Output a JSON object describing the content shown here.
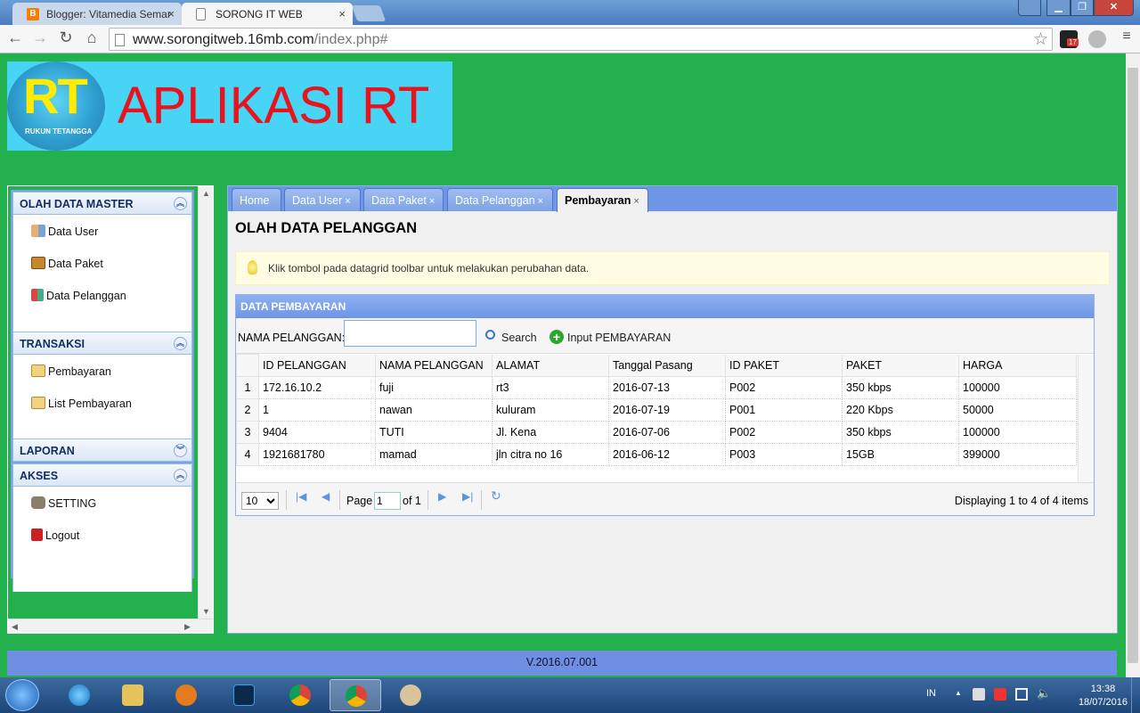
{
  "browser": {
    "tabs": [
      {
        "title": "Blogger: Vitamedia Semar",
        "close": "×"
      },
      {
        "title": "SORONG IT WEB",
        "close": "×"
      }
    ],
    "window_buttons": {
      "min": "▁",
      "max": "❐",
      "close": "✕",
      "user": "👤"
    },
    "url_host": "www.sorongitweb.16mb.com",
    "url_path": "/index.php#",
    "badge": "17"
  },
  "header": {
    "logo_text": "RT",
    "logo_subtext": "RUKUN TETANGGA",
    "title": "APLIKASI RT"
  },
  "sidebar": {
    "sections": [
      {
        "title": "OLAH DATA MASTER",
        "toggle": "︽",
        "items": [
          "Data User",
          "Data Paket",
          "Data Pelanggan"
        ]
      },
      {
        "title": "TRANSAKSI",
        "toggle": "︽",
        "items": [
          "Pembayaran",
          "List Pembayaran"
        ]
      },
      {
        "title": "LAPORAN",
        "toggle": "︾",
        "items": []
      },
      {
        "title": "AKSES",
        "toggle": "︽",
        "items": [
          "SETTING",
          "Logout"
        ]
      }
    ]
  },
  "main": {
    "tabs": [
      {
        "label": "Home",
        "close": ""
      },
      {
        "label": "Data User",
        "close": "×"
      },
      {
        "label": "Data Paket",
        "close": "×"
      },
      {
        "label": "Data Pelanggan",
        "close": "×"
      },
      {
        "label": "Pembayaran",
        "close": "×"
      }
    ],
    "page_title": "OLAH DATA PELANGGAN",
    "info": "Klik tombol pada datagrid toolbar untuk melakukan perubahan data.",
    "grid": {
      "title": "DATA PEMBAYARAN",
      "search_label": "NAMA PELANGGAN:",
      "search_value": "",
      "search_button": "Search",
      "input_button": "Input PEMBAYARAN",
      "columns": [
        "ID PELANGGAN",
        "NAMA PELANGGAN",
        "ALAMAT",
        "Tanggal Pasang",
        "ID PAKET",
        "PAKET",
        "HARGA"
      ],
      "rows": [
        [
          "1",
          "172.16.10.2",
          "fuji",
          "rt3",
          "2016-07-13",
          "P002",
          "350 kbps",
          "100000"
        ],
        [
          "2",
          "1",
          "nawan",
          "kuluram",
          "2016-07-19",
          "P001",
          "220 Kbps",
          "50000"
        ],
        [
          "3",
          "9404",
          "TUTI",
          "Jl. Kena",
          "2016-07-06",
          "P002",
          "350 kbps",
          "100000"
        ],
        [
          "4",
          "1921681780",
          "mamad",
          "jln citra no 16",
          "2016-06-12",
          "P003",
          "15GB",
          "399000"
        ]
      ],
      "pager": {
        "page_size": "10",
        "page_label": "Page",
        "page": "1",
        "of": "of 1",
        "display": "Displaying 1 to 4 of 4 items"
      }
    }
  },
  "footer": {
    "version": "V.2016.07.001"
  },
  "taskbar": {
    "lang": "IN",
    "time": "13:38",
    "date": "18/07/2016"
  },
  "colors": {
    "page_bg": "#22b14c",
    "banner": "#48d4f4",
    "title_red": "#e8131c",
    "panel_blue": "#6e95e6"
  }
}
